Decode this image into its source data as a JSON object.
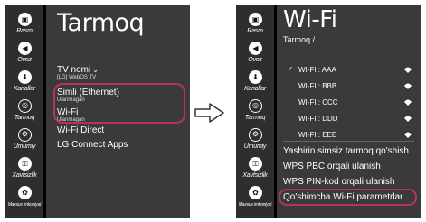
{
  "sidebar": {
    "items": [
      {
        "label": "Rasm",
        "icon": "picture-icon",
        "glyph": "▣"
      },
      {
        "label": "Ovoz",
        "icon": "sound-icon",
        "glyph": "◀"
      },
      {
        "label": "Kanallar",
        "icon": "channels-icon",
        "glyph": "⬇"
      },
      {
        "label": "Tarmoq",
        "icon": "network-icon",
        "glyph": "◎"
      },
      {
        "label": "Umumiy",
        "icon": "general-icon",
        "glyph": "⚙"
      },
      {
        "label": "Xavfsizlik",
        "icon": "safety-icon",
        "glyph": "🔒"
      },
      {
        "label": "Maxsus imkoniyat",
        "icon": "accessibility-icon",
        "glyph": "✿"
      }
    ],
    "selected": "Tarmoq"
  },
  "left_panel": {
    "title": "Tarmoq",
    "items": [
      {
        "label": "TV nomi",
        "sub": "[LG] WebOS TV"
      },
      {
        "label": "Simli (Ethernet)",
        "sub": "Ulanmagan"
      },
      {
        "label": "Wi-Fi",
        "sub": "Ulanmagan"
      },
      {
        "label": "Wi-Fi Direct",
        "sub": ""
      },
      {
        "label": "LG Connect Apps",
        "sub": ""
      }
    ]
  },
  "right_panel": {
    "title": "Wi-Fi",
    "breadcrumb": "Tarmoq /",
    "networks": [
      {
        "name": "WI-FI : AAA",
        "connected": true
      },
      {
        "name": "WI-FI : BBB",
        "connected": false
      },
      {
        "name": "WI-FI : CCC",
        "connected": false
      },
      {
        "name": "WI-FI : DDD",
        "connected": false
      },
      {
        "name": "WI-FI : EEE",
        "connected": false
      }
    ],
    "actions": [
      "Yashirin simsiz tarmoq qo'shish",
      "WPS PBC orqali ulanish",
      "WPS PIN-kod orqali ulanish",
      "Qo'shimcha Wi-Fi parametrlar"
    ]
  },
  "colors": {
    "highlight": "#b8325a",
    "sidebar": "#2e2e2e",
    "panel": "#3a3a3a",
    "background": "#000000"
  }
}
